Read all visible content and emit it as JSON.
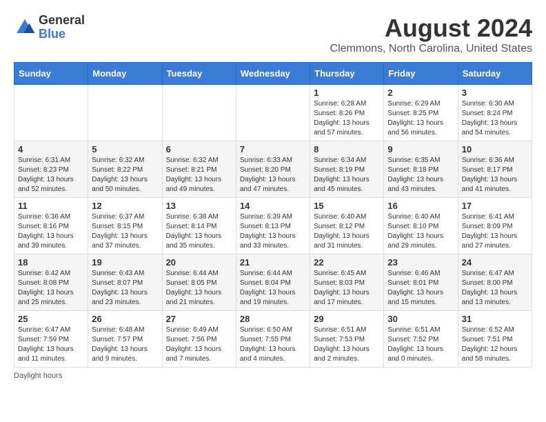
{
  "header": {
    "logo_line1": "General",
    "logo_line2": "Blue",
    "main_title": "August 2024",
    "sub_title": "Clemmons, North Carolina, United States"
  },
  "calendar": {
    "days_of_week": [
      "Sunday",
      "Monday",
      "Tuesday",
      "Wednesday",
      "Thursday",
      "Friday",
      "Saturday"
    ],
    "weeks": [
      [
        {
          "day": "",
          "info": ""
        },
        {
          "day": "",
          "info": ""
        },
        {
          "day": "",
          "info": ""
        },
        {
          "day": "",
          "info": ""
        },
        {
          "day": "1",
          "info": "Sunrise: 6:28 AM\nSunset: 8:26 PM\nDaylight: 13 hours and 57 minutes."
        },
        {
          "day": "2",
          "info": "Sunrise: 6:29 AM\nSunset: 8:25 PM\nDaylight: 13 hours and 56 minutes."
        },
        {
          "day": "3",
          "info": "Sunrise: 6:30 AM\nSunset: 8:24 PM\nDaylight: 13 hours and 54 minutes."
        }
      ],
      [
        {
          "day": "4",
          "info": "Sunrise: 6:31 AM\nSunset: 8:23 PM\nDaylight: 13 hours and 52 minutes."
        },
        {
          "day": "5",
          "info": "Sunrise: 6:32 AM\nSunset: 8:22 PM\nDaylight: 13 hours and 50 minutes."
        },
        {
          "day": "6",
          "info": "Sunrise: 6:32 AM\nSunset: 8:21 PM\nDaylight: 13 hours and 49 minutes."
        },
        {
          "day": "7",
          "info": "Sunrise: 6:33 AM\nSunset: 8:20 PM\nDaylight: 13 hours and 47 minutes."
        },
        {
          "day": "8",
          "info": "Sunrise: 6:34 AM\nSunset: 8:19 PM\nDaylight: 13 hours and 45 minutes."
        },
        {
          "day": "9",
          "info": "Sunrise: 6:35 AM\nSunset: 8:18 PM\nDaylight: 13 hours and 43 minutes."
        },
        {
          "day": "10",
          "info": "Sunrise: 6:36 AM\nSunset: 8:17 PM\nDaylight: 13 hours and 41 minutes."
        }
      ],
      [
        {
          "day": "11",
          "info": "Sunrise: 6:36 AM\nSunset: 8:16 PM\nDaylight: 13 hours and 39 minutes."
        },
        {
          "day": "12",
          "info": "Sunrise: 6:37 AM\nSunset: 8:15 PM\nDaylight: 13 hours and 37 minutes."
        },
        {
          "day": "13",
          "info": "Sunrise: 6:38 AM\nSunset: 8:14 PM\nDaylight: 13 hours and 35 minutes."
        },
        {
          "day": "14",
          "info": "Sunrise: 6:39 AM\nSunset: 8:13 PM\nDaylight: 13 hours and 33 minutes."
        },
        {
          "day": "15",
          "info": "Sunrise: 6:40 AM\nSunset: 8:12 PM\nDaylight: 13 hours and 31 minutes."
        },
        {
          "day": "16",
          "info": "Sunrise: 6:40 AM\nSunset: 8:10 PM\nDaylight: 13 hours and 29 minutes."
        },
        {
          "day": "17",
          "info": "Sunrise: 6:41 AM\nSunset: 8:09 PM\nDaylight: 13 hours and 27 minutes."
        }
      ],
      [
        {
          "day": "18",
          "info": "Sunrise: 6:42 AM\nSunset: 8:08 PM\nDaylight: 13 hours and 25 minutes."
        },
        {
          "day": "19",
          "info": "Sunrise: 6:43 AM\nSunset: 8:07 PM\nDaylight: 13 hours and 23 minutes."
        },
        {
          "day": "20",
          "info": "Sunrise: 6:44 AM\nSunset: 8:05 PM\nDaylight: 13 hours and 21 minutes."
        },
        {
          "day": "21",
          "info": "Sunrise: 6:44 AM\nSunset: 8:04 PM\nDaylight: 13 hours and 19 minutes."
        },
        {
          "day": "22",
          "info": "Sunrise: 6:45 AM\nSunset: 8:03 PM\nDaylight: 13 hours and 17 minutes."
        },
        {
          "day": "23",
          "info": "Sunrise: 6:46 AM\nSunset: 8:01 PM\nDaylight: 13 hours and 15 minutes."
        },
        {
          "day": "24",
          "info": "Sunrise: 6:47 AM\nSunset: 8:00 PM\nDaylight: 13 hours and 13 minutes."
        }
      ],
      [
        {
          "day": "25",
          "info": "Sunrise: 6:47 AM\nSunset: 7:59 PM\nDaylight: 13 hours and 11 minutes."
        },
        {
          "day": "26",
          "info": "Sunrise: 6:48 AM\nSunset: 7:57 PM\nDaylight: 13 hours and 9 minutes."
        },
        {
          "day": "27",
          "info": "Sunrise: 6:49 AM\nSunset: 7:56 PM\nDaylight: 13 hours and 7 minutes."
        },
        {
          "day": "28",
          "info": "Sunrise: 6:50 AM\nSunset: 7:55 PM\nDaylight: 13 hours and 4 minutes."
        },
        {
          "day": "29",
          "info": "Sunrise: 6:51 AM\nSunset: 7:53 PM\nDaylight: 13 hours and 2 minutes."
        },
        {
          "day": "30",
          "info": "Sunrise: 6:51 AM\nSunset: 7:52 PM\nDaylight: 13 hours and 0 minutes."
        },
        {
          "day": "31",
          "info": "Sunrise: 6:52 AM\nSunset: 7:51 PM\nDaylight: 12 hours and 58 minutes."
        }
      ]
    ]
  },
  "footer": {
    "note": "Daylight hours"
  }
}
